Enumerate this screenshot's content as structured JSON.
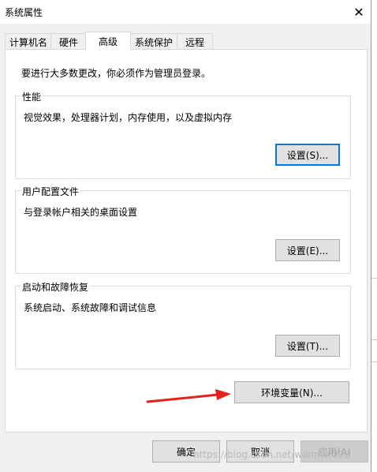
{
  "window": {
    "title": "系统属性",
    "close_glyph": "✕"
  },
  "tabs": [
    {
      "label": "计算机名",
      "active": false
    },
    {
      "label": "硬件",
      "active": false
    },
    {
      "label": "高级",
      "active": true
    },
    {
      "label": "系统保护",
      "active": false
    },
    {
      "label": "远程",
      "active": false
    }
  ],
  "intro": "要进行大多数更改，你必须作为管理员登录。",
  "groups": {
    "performance": {
      "label": "性能",
      "desc": "视觉效果，处理器计划，内存使用，以及虚拟内存",
      "button": "设置(S)..."
    },
    "profile": {
      "label": "用户配置文件",
      "desc": "与登录帐户相关的桌面设置",
      "button": "设置(E)..."
    },
    "startup": {
      "label": "启动和故障恢复",
      "desc": "系统启动、系统故障和调试信息",
      "button": "设置(T)..."
    }
  },
  "env_button": "环境变量(N)...",
  "dialog_buttons": {
    "ok": "确定",
    "cancel": "取消",
    "apply": "应用(A)"
  },
  "watermark": "https://blog.csdn.net/wanmei002",
  "colors": {
    "accent": "#0078d7",
    "arrow": "#e8201a"
  }
}
